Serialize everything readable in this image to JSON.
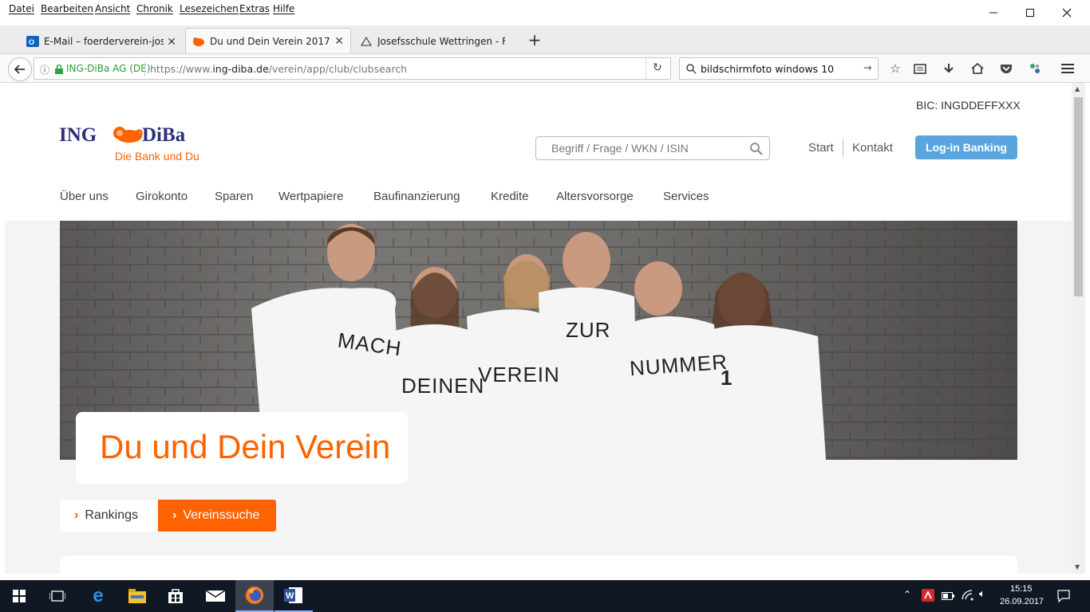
{
  "menubar": {
    "items": [
      "Datei",
      "Bearbeiten",
      "Ansicht",
      "Chronik",
      "Lesezeichen",
      "Extras",
      "Hilfe"
    ]
  },
  "tabs": [
    {
      "title": "E-Mail – foerderverein-josefs",
      "icon": "outlook-icon"
    },
    {
      "title": "Du und Dein Verein 2017",
      "icon": "ing-lion-icon"
    },
    {
      "title": "Josefsschule Wettringen - Fö",
      "icon": "school-icon"
    }
  ],
  "url": {
    "identity": "ING-DiBa AG (DE)",
    "prefix": "https://www.",
    "domain": "ing-diba.de",
    "path": "/verein/app/club/clubsearch"
  },
  "search": {
    "value": "bildschirmfoto windows 10"
  },
  "site": {
    "bic": "BIC: INGDDEFFXXX",
    "logo_ing": "ING",
    "logo_diba": "DiBa",
    "tagline": "Die Bank und Du",
    "search_placeholder": "Begriff / Frage / WKN / ISIN",
    "start": "Start",
    "kontakt": "Kontakt",
    "login": "Log-in Banking",
    "nav": [
      "Über uns",
      "Girokonto",
      "Sparen",
      "Wertpapiere",
      "Baufinanzierung",
      "Kredite",
      "Altersvorsorge",
      "Services"
    ],
    "hero_shirts": [
      "MACH",
      "DEINEN",
      "VEREIN",
      "ZUR",
      "NUMMER",
      "1"
    ],
    "hero_title": "Du und Dein Verein",
    "btn_rankings": "Rankings",
    "btn_vereinssuche": "Vereinssuche"
  },
  "taskbar": {
    "time": "15:15",
    "date": "26.09.2017"
  },
  "colors": {
    "ing_orange": "#ff6200",
    "ing_navy": "#2c2f7c",
    "login_blue": "#5aa5dd"
  }
}
